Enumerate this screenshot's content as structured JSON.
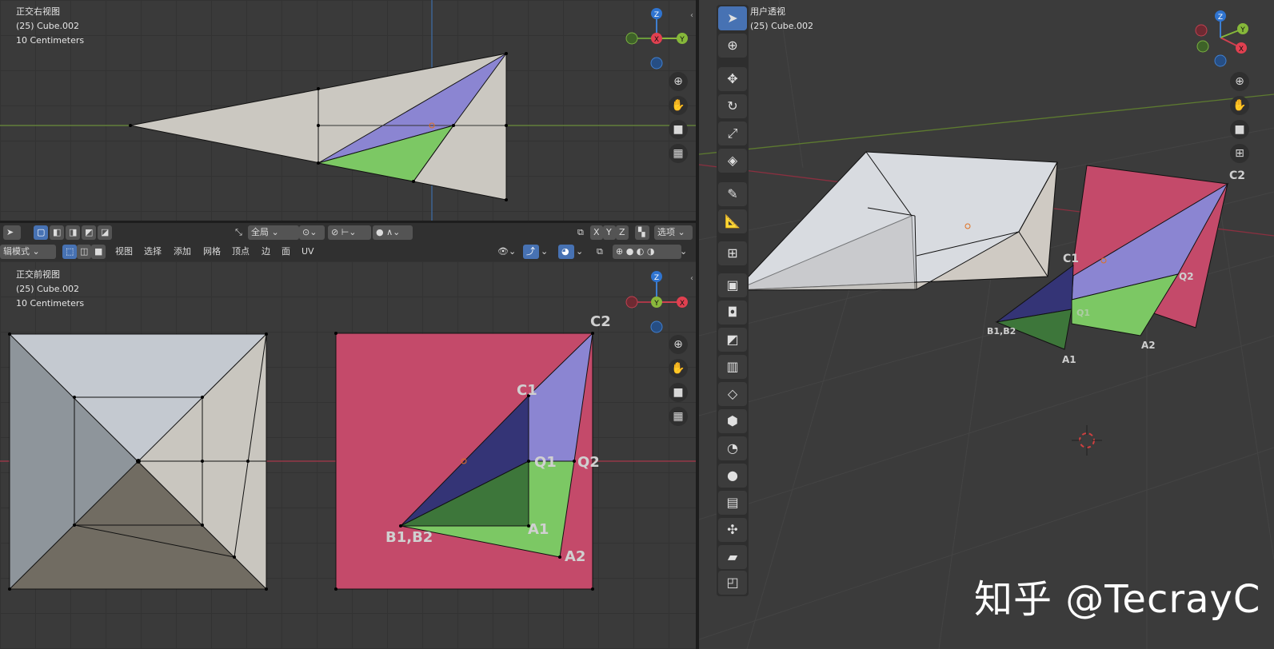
{
  "top_view": {
    "title": "正交右视图",
    "object": "(25) Cube.002",
    "scale": "10 Centimeters"
  },
  "front_view": {
    "title": "正交前视图",
    "object": "(25) Cube.002",
    "scale": "10 Centimeters"
  },
  "user_view": {
    "title": "用户透视",
    "object": "(25) Cube.002"
  },
  "header": {
    "transform_space": "全局",
    "axes": [
      "X",
      "Y",
      "Z"
    ],
    "options_label": "选项",
    "mode_label": "辑模式",
    "menu": [
      "视图",
      "选择",
      "添加",
      "网格",
      "顶点",
      "边",
      "面",
      "UV"
    ]
  },
  "gizmo_labels": {
    "z": "Z",
    "x": "X",
    "y": "Y"
  },
  "front_labels": {
    "c2": "C2",
    "c1": "C1",
    "q1": "Q1",
    "q2": "Q2",
    "b": "B1,B2",
    "a1": "A1",
    "a2": "A2"
  },
  "persp_labels": {
    "c2": "C2",
    "c1": "C1",
    "q2": "Q2",
    "q1": "Q1",
    "b": "B1,B2",
    "a1": "A1",
    "a2": "A2"
  },
  "watermark": "知乎 @TecrayC",
  "colors": {
    "pink": "#c44a6a",
    "purple": "#8b85d2",
    "navy": "#343476",
    "dark_green": "#3d763a",
    "light_green": "#7cc864",
    "gray_face": "#cbc8c1",
    "accent_blue": "#4772b3"
  }
}
